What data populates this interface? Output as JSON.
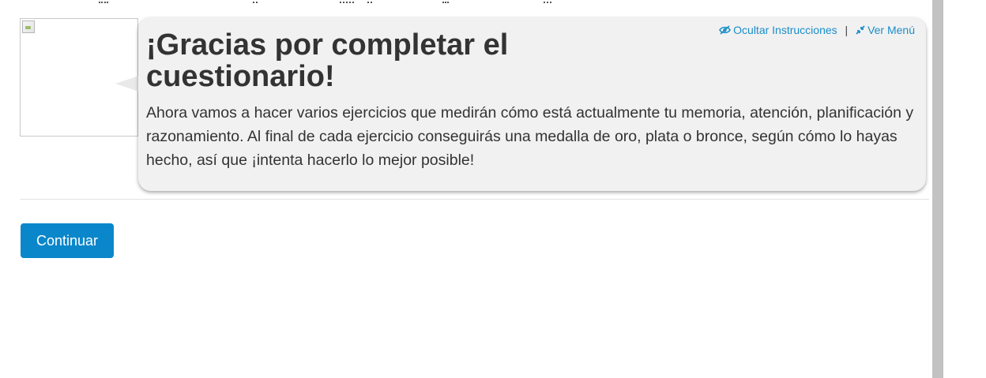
{
  "instructions": {
    "title": "¡Gracias por completar el cuestionario!",
    "body": "Ahora vamos a hacer varios ejercicios que medirán cómo está actualmente tu memoria, atención, planificación y razonamiento. Al final de cada ejercicio conseguirás una medalla de oro, plata o bronce, según cómo lo hayas hecho, así que ¡intenta hacerlo lo mejor posible!",
    "hide_label": "Ocultar Instrucciones",
    "hide_icon": "eye-slash-icon",
    "separator": "|",
    "menu_label": "Ver Menú",
    "menu_icon": "compress-icon"
  },
  "actions": {
    "continue_label": "Continuar"
  },
  "colors": {
    "accent": "#0a87ca",
    "link": "#1a8ec9",
    "bubble_bg": "#f1f1f1",
    "text": "#333333"
  }
}
